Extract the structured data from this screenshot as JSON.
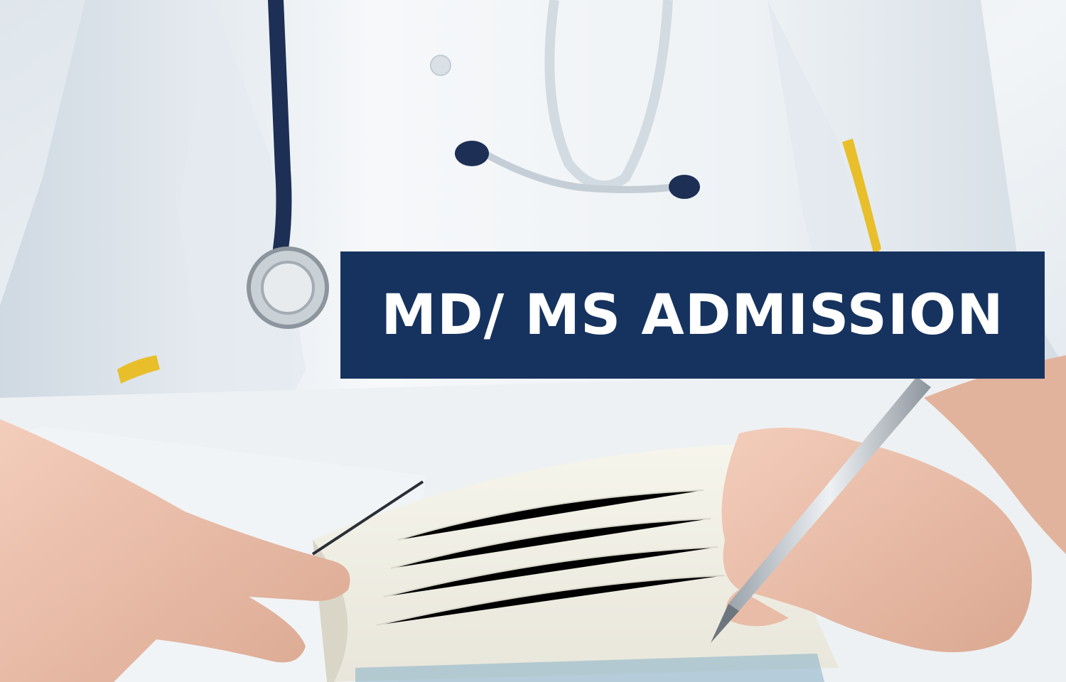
{
  "banner": {
    "text": "MD/ MS ADMISSION",
    "background_color": "#16335f",
    "text_color": "#ffffff"
  },
  "photo": {
    "subject_elements": [
      "white-coat",
      "stethoscope",
      "notebook",
      "hands",
      "pen"
    ]
  }
}
